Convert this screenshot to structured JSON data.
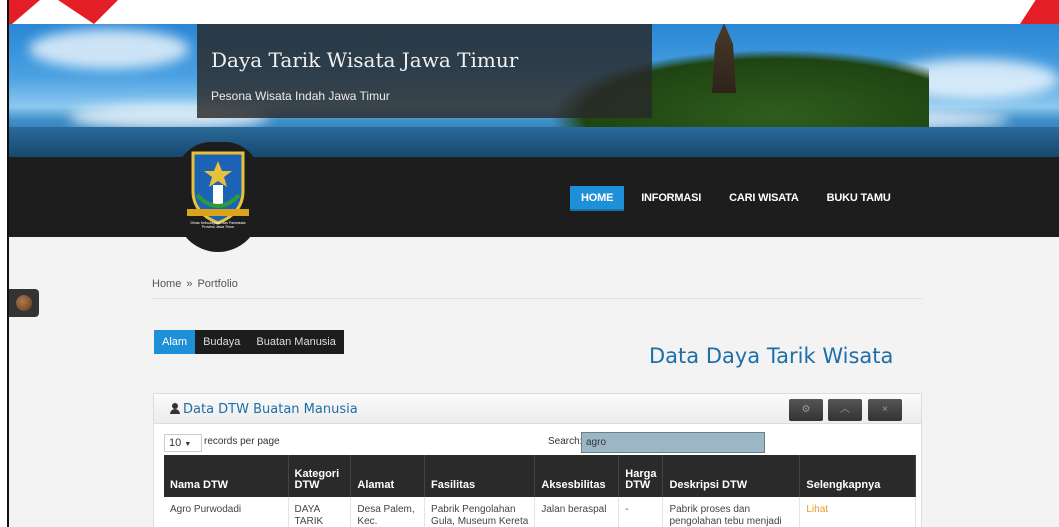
{
  "header": {
    "site_title": "Daya Tarik Wisata Jawa Timur",
    "site_subtitle": "Pesona Wisata Indah Jawa Timur"
  },
  "logo": {
    "caption_line1": "Dinas Kebudayaan dan Pariwisata",
    "caption_line2": "Provinsi Jawa Timur"
  },
  "nav": {
    "items": [
      {
        "label": "HOME",
        "active": true
      },
      {
        "label": "INFORMASI",
        "active": false
      },
      {
        "label": "CARI WISATA",
        "active": false
      },
      {
        "label": "BUKU TAMU",
        "active": false
      }
    ]
  },
  "breadcrumb": {
    "home": "Home",
    "separator": "»",
    "current": "Portfolio"
  },
  "category_tabs": [
    {
      "label": "Alam",
      "active": true
    },
    {
      "label": "Budaya",
      "active": false
    },
    {
      "label": "Buatan Manusia",
      "active": false
    }
  ],
  "page_heading": "Data Daya Tarik Wisata",
  "box": {
    "title": "Data DTW Buatan Manusia",
    "buttons": [
      {
        "icon": "gear-icon",
        "glyph": "⚙"
      },
      {
        "icon": "chevron-up-icon",
        "glyph": "︿"
      },
      {
        "icon": "close-icon",
        "glyph": "×"
      }
    ]
  },
  "table_controls": {
    "records_per_page_value": "10",
    "records_per_page_label": "records per page",
    "search_label": "Search:",
    "search_value": "agro"
  },
  "table": {
    "columns": [
      "Nama DTW",
      "Kategori DTW",
      "Alamat",
      "Fasilitas",
      "Aksesbilitas",
      "Harga DTW",
      "Deskripsi DTW",
      "Selengkapnya"
    ],
    "rows": [
      {
        "nama": "Agro Purwodadi",
        "kategori": "DAYA TARIK",
        "alamat": "Desa Palem, Kec.",
        "fasilitas": "Pabrik Pengolahan Gula, Museum Kereta",
        "aksesbilitas": "Jalan beraspal",
        "harga": "-",
        "deskripsi": "Pabrik proses dan pengolahan tebu menjadi",
        "link": "Lihat"
      }
    ]
  },
  "colors": {
    "accent": "#1e90d8",
    "navbar": "#1d1d1d",
    "heading": "#1e6ea8",
    "link": "#e89d24"
  }
}
